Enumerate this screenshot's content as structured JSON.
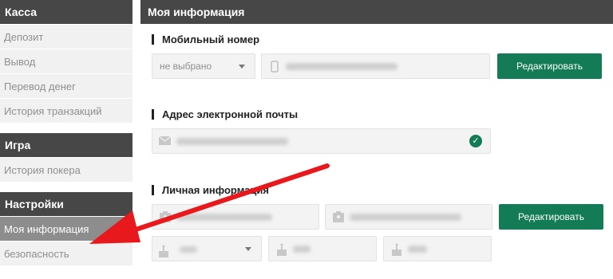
{
  "sidebar": {
    "cashier": {
      "title": "Касса",
      "items": [
        "Депозит",
        "Вывод",
        "Перевод денег",
        "История транзакций"
      ]
    },
    "game": {
      "title": "Игра",
      "items": [
        "История покера"
      ]
    },
    "settings": {
      "title": "Настройки",
      "items": [
        "Моя информация",
        "безопасность"
      ]
    }
  },
  "main": {
    "title": "Моя информация",
    "mobile": {
      "title": "Мобильный номер",
      "select_value": "не выбрано",
      "edit_label": "Редактировать"
    },
    "email": {
      "title": "Адрес электронной почты"
    },
    "personal": {
      "title": "Личная информация",
      "edit_label": "Редактировать"
    }
  },
  "colors": {
    "header": "#474747",
    "accent": "#137c56",
    "arrow": "#e8191c"
  }
}
